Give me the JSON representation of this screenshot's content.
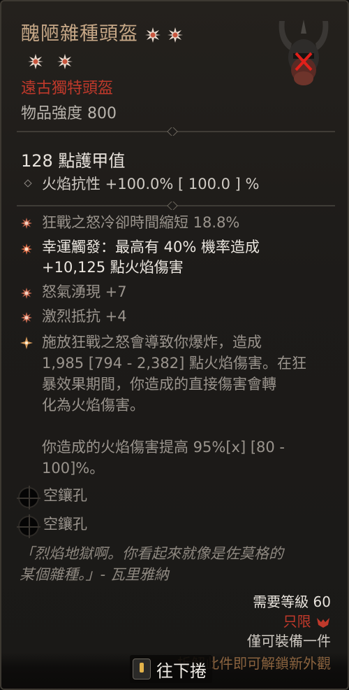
{
  "item": {
    "name": "醜陋雜種頭盔",
    "type": "遠古獨特頭盔",
    "power": "物品強度 800",
    "armor": "128 點護甲值",
    "implicit": "火焰抗性 +100.0%   [ 100.0 ] %",
    "affixes": [
      "狂戰之怒冷卻時間縮短 18.8%",
      "幸運觸發：最高有 40% 機率造成",
      "+10,125 點火焰傷害",
      "怒氣湧現 +7",
      "激烈抵抗 +4"
    ],
    "unique_power": [
      "施放狂戰之怒會導致你爆炸，造成",
      "1,985 [794 - 2,382] 點火焰傷害。在狂",
      "暴效果期間，你造成的直接傷害會轉",
      "化為火焰傷害。",
      "",
      "你造成的火焰傷害提高 95%[x] [80 -",
      "100]%。"
    ],
    "sockets": [
      "空鑲孔",
      "空鑲孔"
    ],
    "flavor": [
      "「烈焰地獄啊。你看起來就像是佐莫格的",
      "某個雜種。」- 瓦里雅納"
    ],
    "requirements": {
      "level": "需要等級 60",
      "class": "只限",
      "unique_equip": "僅可裝備一件",
      "unlock_text": "拆解此件即可解鎖新外觀"
    }
  },
  "controls": {
    "scroll_label": "往下捲"
  },
  "colors": {
    "title": "#c7a887",
    "type": "#c0392b",
    "accent": "#a8774a"
  },
  "icons": {
    "star": "star-icon",
    "helm": "helm-icon",
    "class": "barbarian-icon"
  }
}
